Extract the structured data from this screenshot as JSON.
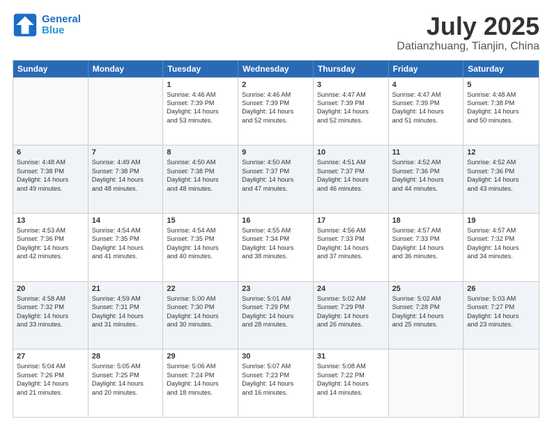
{
  "logo": {
    "line1": "General",
    "line2": "Blue"
  },
  "header": {
    "month": "July 2025",
    "location": "Datianzhuang, Tianjin, China"
  },
  "weekdays": [
    "Sunday",
    "Monday",
    "Tuesday",
    "Wednesday",
    "Thursday",
    "Friday",
    "Saturday"
  ],
  "weeks": [
    [
      {
        "day": "",
        "lines": []
      },
      {
        "day": "",
        "lines": []
      },
      {
        "day": "1",
        "lines": [
          "Sunrise: 4:46 AM",
          "Sunset: 7:39 PM",
          "Daylight: 14 hours",
          "and 53 minutes."
        ]
      },
      {
        "day": "2",
        "lines": [
          "Sunrise: 4:46 AM",
          "Sunset: 7:39 PM",
          "Daylight: 14 hours",
          "and 52 minutes."
        ]
      },
      {
        "day": "3",
        "lines": [
          "Sunrise: 4:47 AM",
          "Sunset: 7:39 PM",
          "Daylight: 14 hours",
          "and 52 minutes."
        ]
      },
      {
        "day": "4",
        "lines": [
          "Sunrise: 4:47 AM",
          "Sunset: 7:39 PM",
          "Daylight: 14 hours",
          "and 51 minutes."
        ]
      },
      {
        "day": "5",
        "lines": [
          "Sunrise: 4:48 AM",
          "Sunset: 7:38 PM",
          "Daylight: 14 hours",
          "and 50 minutes."
        ]
      }
    ],
    [
      {
        "day": "6",
        "lines": [
          "Sunrise: 4:48 AM",
          "Sunset: 7:38 PM",
          "Daylight: 14 hours",
          "and 49 minutes."
        ]
      },
      {
        "day": "7",
        "lines": [
          "Sunrise: 4:49 AM",
          "Sunset: 7:38 PM",
          "Daylight: 14 hours",
          "and 48 minutes."
        ]
      },
      {
        "day": "8",
        "lines": [
          "Sunrise: 4:50 AM",
          "Sunset: 7:38 PM",
          "Daylight: 14 hours",
          "and 48 minutes."
        ]
      },
      {
        "day": "9",
        "lines": [
          "Sunrise: 4:50 AM",
          "Sunset: 7:37 PM",
          "Daylight: 14 hours",
          "and 47 minutes."
        ]
      },
      {
        "day": "10",
        "lines": [
          "Sunrise: 4:51 AM",
          "Sunset: 7:37 PM",
          "Daylight: 14 hours",
          "and 46 minutes."
        ]
      },
      {
        "day": "11",
        "lines": [
          "Sunrise: 4:52 AM",
          "Sunset: 7:36 PM",
          "Daylight: 14 hours",
          "and 44 minutes."
        ]
      },
      {
        "day": "12",
        "lines": [
          "Sunrise: 4:52 AM",
          "Sunset: 7:36 PM",
          "Daylight: 14 hours",
          "and 43 minutes."
        ]
      }
    ],
    [
      {
        "day": "13",
        "lines": [
          "Sunrise: 4:53 AM",
          "Sunset: 7:36 PM",
          "Daylight: 14 hours",
          "and 42 minutes."
        ]
      },
      {
        "day": "14",
        "lines": [
          "Sunrise: 4:54 AM",
          "Sunset: 7:35 PM",
          "Daylight: 14 hours",
          "and 41 minutes."
        ]
      },
      {
        "day": "15",
        "lines": [
          "Sunrise: 4:54 AM",
          "Sunset: 7:35 PM",
          "Daylight: 14 hours",
          "and 40 minutes."
        ]
      },
      {
        "day": "16",
        "lines": [
          "Sunrise: 4:55 AM",
          "Sunset: 7:34 PM",
          "Daylight: 14 hours",
          "and 38 minutes."
        ]
      },
      {
        "day": "17",
        "lines": [
          "Sunrise: 4:56 AM",
          "Sunset: 7:33 PM",
          "Daylight: 14 hours",
          "and 37 minutes."
        ]
      },
      {
        "day": "18",
        "lines": [
          "Sunrise: 4:57 AM",
          "Sunset: 7:33 PM",
          "Daylight: 14 hours",
          "and 36 minutes."
        ]
      },
      {
        "day": "19",
        "lines": [
          "Sunrise: 4:57 AM",
          "Sunset: 7:32 PM",
          "Daylight: 14 hours",
          "and 34 minutes."
        ]
      }
    ],
    [
      {
        "day": "20",
        "lines": [
          "Sunrise: 4:58 AM",
          "Sunset: 7:32 PM",
          "Daylight: 14 hours",
          "and 33 minutes."
        ]
      },
      {
        "day": "21",
        "lines": [
          "Sunrise: 4:59 AM",
          "Sunset: 7:31 PM",
          "Daylight: 14 hours",
          "and 31 minutes."
        ]
      },
      {
        "day": "22",
        "lines": [
          "Sunrise: 5:00 AM",
          "Sunset: 7:30 PM",
          "Daylight: 14 hours",
          "and 30 minutes."
        ]
      },
      {
        "day": "23",
        "lines": [
          "Sunrise: 5:01 AM",
          "Sunset: 7:29 PM",
          "Daylight: 14 hours",
          "and 28 minutes."
        ]
      },
      {
        "day": "24",
        "lines": [
          "Sunrise: 5:02 AM",
          "Sunset: 7:29 PM",
          "Daylight: 14 hours",
          "and 26 minutes."
        ]
      },
      {
        "day": "25",
        "lines": [
          "Sunrise: 5:02 AM",
          "Sunset: 7:28 PM",
          "Daylight: 14 hours",
          "and 25 minutes."
        ]
      },
      {
        "day": "26",
        "lines": [
          "Sunrise: 5:03 AM",
          "Sunset: 7:27 PM",
          "Daylight: 14 hours",
          "and 23 minutes."
        ]
      }
    ],
    [
      {
        "day": "27",
        "lines": [
          "Sunrise: 5:04 AM",
          "Sunset: 7:26 PM",
          "Daylight: 14 hours",
          "and 21 minutes."
        ]
      },
      {
        "day": "28",
        "lines": [
          "Sunrise: 5:05 AM",
          "Sunset: 7:25 PM",
          "Daylight: 14 hours",
          "and 20 minutes."
        ]
      },
      {
        "day": "29",
        "lines": [
          "Sunrise: 5:06 AM",
          "Sunset: 7:24 PM",
          "Daylight: 14 hours",
          "and 18 minutes."
        ]
      },
      {
        "day": "30",
        "lines": [
          "Sunrise: 5:07 AM",
          "Sunset: 7:23 PM",
          "Daylight: 14 hours",
          "and 16 minutes."
        ]
      },
      {
        "day": "31",
        "lines": [
          "Sunrise: 5:08 AM",
          "Sunset: 7:22 PM",
          "Daylight: 14 hours",
          "and 14 minutes."
        ]
      },
      {
        "day": "",
        "lines": []
      },
      {
        "day": "",
        "lines": []
      }
    ]
  ]
}
